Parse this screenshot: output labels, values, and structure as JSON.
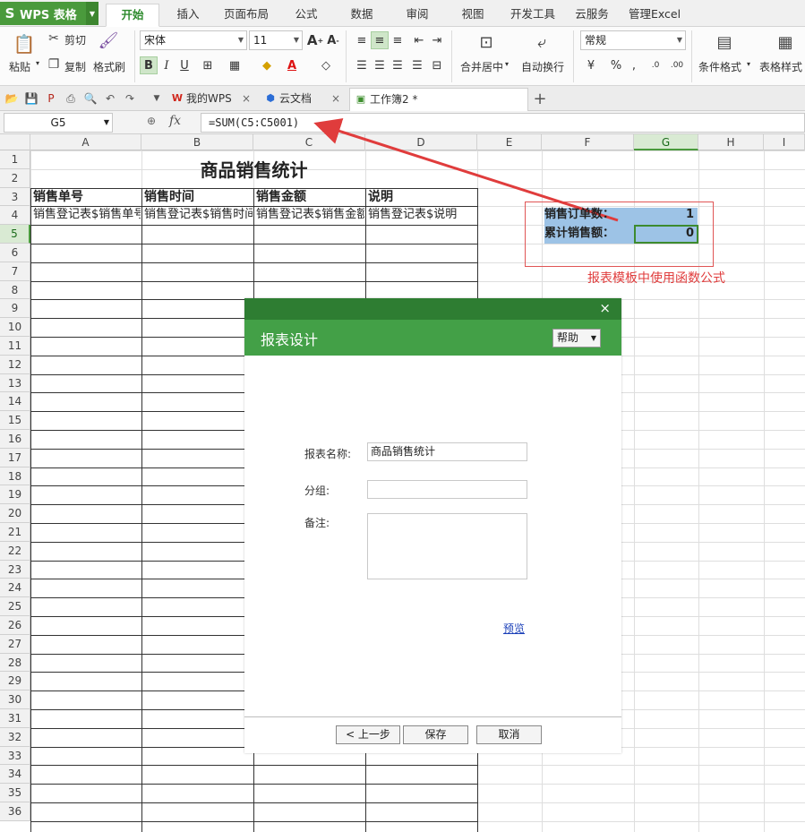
{
  "app": {
    "name": "WPS 表格",
    "logo": "S"
  },
  "menu": {
    "tabs": [
      "开始",
      "插入",
      "页面布局",
      "公式",
      "数据",
      "审阅",
      "视图",
      "开发工具",
      "云服务",
      "管理Excel"
    ]
  },
  "ribbon": {
    "paste": "粘贴",
    "cut": "剪切",
    "copy": "复制",
    "format_painter": "格式刷",
    "font_name": "宋体",
    "font_size": "11",
    "merge": "合并居中",
    "wrap": "自动换行",
    "number_format": "常规",
    "cond_format": "条件格式",
    "table_style": "表格样式"
  },
  "docs": {
    "tabs": [
      "我的WPS",
      "云文档",
      "工作簿2 *"
    ]
  },
  "formula_bar": {
    "cell_ref": "G5",
    "fx": "fx",
    "formula": "=SUM(C5:C5001)"
  },
  "columns": [
    "A",
    "B",
    "C",
    "D",
    "E",
    "F",
    "G",
    "H",
    "I"
  ],
  "rows": [
    "1",
    "2",
    "3",
    "4",
    "5",
    "6",
    "7",
    "8",
    "9",
    "10",
    "11",
    "12",
    "13",
    "14",
    "15",
    "16",
    "17",
    "18",
    "19",
    "20",
    "21",
    "22",
    "23",
    "24",
    "25",
    "26",
    "27",
    "28",
    "29",
    "30",
    "31",
    "32",
    "33",
    "34",
    "35",
    "36"
  ],
  "sheet": {
    "title": "商品销售统计",
    "headers": [
      "销售单号",
      "销售时间",
      "销售金额",
      "说明"
    ],
    "row4": [
      "销售登记表$销售单号",
      "销售登记表$销售时间",
      "销售登记表$销售金额",
      "销售登记表$说明"
    ],
    "summary": [
      {
        "label": "销售订单数：",
        "value": "1"
      },
      {
        "label": "累计销售额：",
        "value": "0"
      }
    ]
  },
  "annotation": "报表模板中使用函数公式",
  "dialog": {
    "title": "报表设计",
    "help": "帮助",
    "close": "×",
    "name_label": "报表名称:",
    "name_value": "商品销售统计",
    "group_label": "分组:",
    "group_value": "",
    "note_label": "备注:",
    "note_value": "",
    "preview": "预览",
    "prev_btn": "< 上一步",
    "save_btn": "保存",
    "cancel_btn": "取消"
  },
  "colors": {
    "accent": "#43a047",
    "dark_accent": "#2e7d32",
    "annotation": "#e03c3c",
    "summary_fill": "#9dc3e6"
  }
}
